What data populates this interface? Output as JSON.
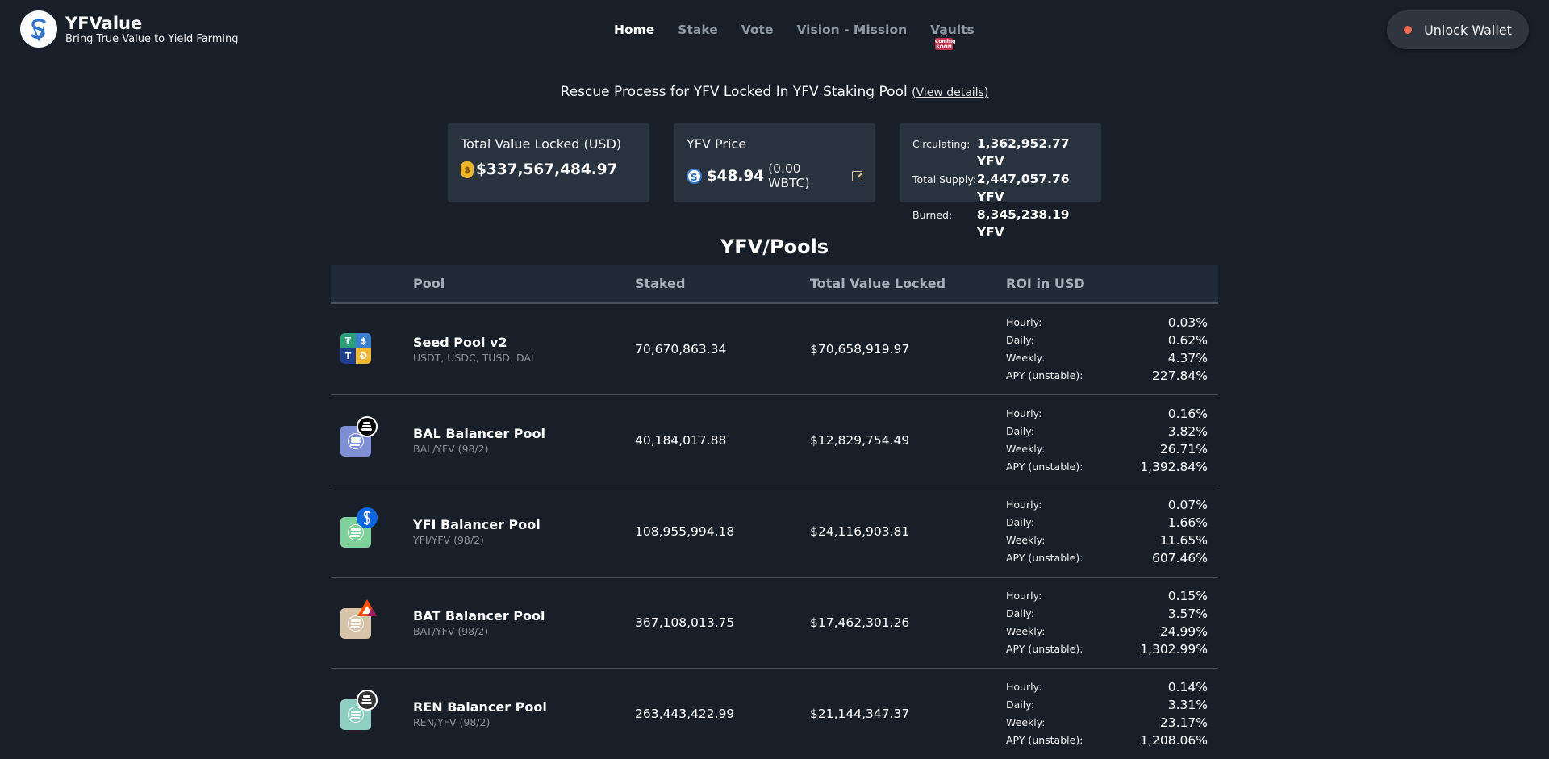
{
  "brand": {
    "name": "YFValue",
    "tagline": "Bring True Value to Yield Farming",
    "logo_glyph": "S"
  },
  "nav": {
    "items": [
      {
        "label": "Home",
        "active": true
      },
      {
        "label": "Stake",
        "active": false
      },
      {
        "label": "Vote",
        "active": false
      },
      {
        "label": "Vision - Mission",
        "active": false
      },
      {
        "label": "Vaults",
        "active": false
      }
    ],
    "coming_soon_badge": "Coming SOON"
  },
  "wallet": {
    "label": "Unlock Wallet",
    "status_color": "#f36a56"
  },
  "notice": {
    "text": "Rescue Process for YFV Locked In YFV Staking Pool",
    "link": "(View details)"
  },
  "stats": {
    "tvl": {
      "title": "Total Value Locked (USD)",
      "value": "$337,567,484.97",
      "icon": "money-bag-icon",
      "icon_glyph": "$"
    },
    "price": {
      "title": "YFV Price",
      "value": "$48.94",
      "sub": "(0.00 WBTC)",
      "icon_glyph": "S"
    },
    "supply": {
      "rows": [
        {
          "label": "Circulating:",
          "value": "1,362,952.77 YFV"
        },
        {
          "label": "Total Supply:",
          "value": "2,447,057.76 YFV"
        },
        {
          "label": "Burned:",
          "value": "8,345,238.19 YFV"
        }
      ]
    }
  },
  "pools": {
    "title": "YFV/Pools",
    "headers": {
      "pool": "Pool",
      "staked": "Staked",
      "tvl": "Total Value Locked",
      "roi": "ROI in USD"
    },
    "roi_labels": {
      "hourly": "Hourly:",
      "daily": "Daily:",
      "weekly": "Weekly:",
      "apy": "APY (unstable):"
    },
    "rows": [
      {
        "name": "Seed Pool v2",
        "tokens": "USDT, USDC, TUSD, DAI",
        "staked": "70,670,863.34",
        "tvl": "$70,658,919.97",
        "hourly": "0.03%",
        "daily": "0.62%",
        "weekly": "4.37%",
        "apy": "227.84%",
        "icon": "seed-pool-icon",
        "seed_glyphs": [
          "₮",
          "$",
          "T",
          "Đ"
        ],
        "seed_colors": [
          "#2d9f78",
          "#3b7fd0",
          "#1d3d8c",
          "#f4b731"
        ]
      },
      {
        "name": "BAL Balancer Pool",
        "tokens": "BAL/YFV (98/2)",
        "staked": "40,184,017.88",
        "tvl": "$12,829,754.49",
        "hourly": "0.16%",
        "daily": "3.82%",
        "weekly": "26.71%",
        "apy": "1,392.84%",
        "icon": "bal-icon",
        "square_color": "#7f8fd4",
        "badge_color": "#000000"
      },
      {
        "name": "YFI Balancer Pool",
        "tokens": "YFI/YFV (98/2)",
        "staked": "108,955,994.18",
        "tvl": "$24,116,903.81",
        "hourly": "0.07%",
        "daily": "1.66%",
        "weekly": "11.65%",
        "apy": "607.46%",
        "icon": "yfi-icon",
        "square_color": "#7fd09a",
        "badge_color": "#0a66e0"
      },
      {
        "name": "BAT Balancer Pool",
        "tokens": "BAT/YFV (98/2)",
        "staked": "367,108,013.75",
        "tvl": "$17,462,301.26",
        "hourly": "0.15%",
        "daily": "3.57%",
        "weekly": "24.99%",
        "apy": "1,302.99%",
        "icon": "bat-icon",
        "square_color": "#d6c3a8",
        "badge_color": "#ff5000"
      },
      {
        "name": "REN Balancer Pool",
        "tokens": "REN/YFV (98/2)",
        "staked": "263,443,422.99",
        "tvl": "$21,144,347.37",
        "hourly": "0.14%",
        "daily": "3.31%",
        "weekly": "23.17%",
        "apy": "1,208.06%",
        "icon": "ren-icon",
        "square_color": "#8fcfc2",
        "badge_color": "#333333"
      }
    ]
  }
}
